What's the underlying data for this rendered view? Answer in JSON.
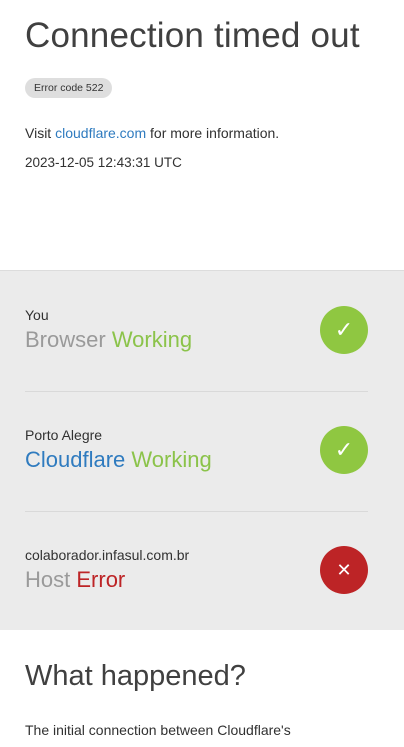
{
  "header": {
    "title": "Connection timed out",
    "error_code": "Error code 522",
    "visit_prefix": "Visit ",
    "visit_link": "cloudflare.com",
    "visit_suffix": " for more information.",
    "timestamp": "2023-12-05 12:43:31 UTC"
  },
  "status": {
    "rows": [
      {
        "location": "You",
        "label": "Browser",
        "state": "Working",
        "icon": "check-icon",
        "ok": true
      },
      {
        "location": "Porto Alegre",
        "label": "Cloudflare",
        "state": "Working",
        "icon": "check-icon",
        "ok": true
      },
      {
        "location": "colaborador.infasul.com.br",
        "label": "Host",
        "state": "Error",
        "icon": "close-icon",
        "ok": false
      }
    ],
    "colors": {
      "ok": "#8fc741",
      "error": "#bd2426",
      "link": "#2f7bbf"
    }
  },
  "what_happened": {
    "heading": "What happened?",
    "text": "The initial connection between Cloudflare's"
  }
}
